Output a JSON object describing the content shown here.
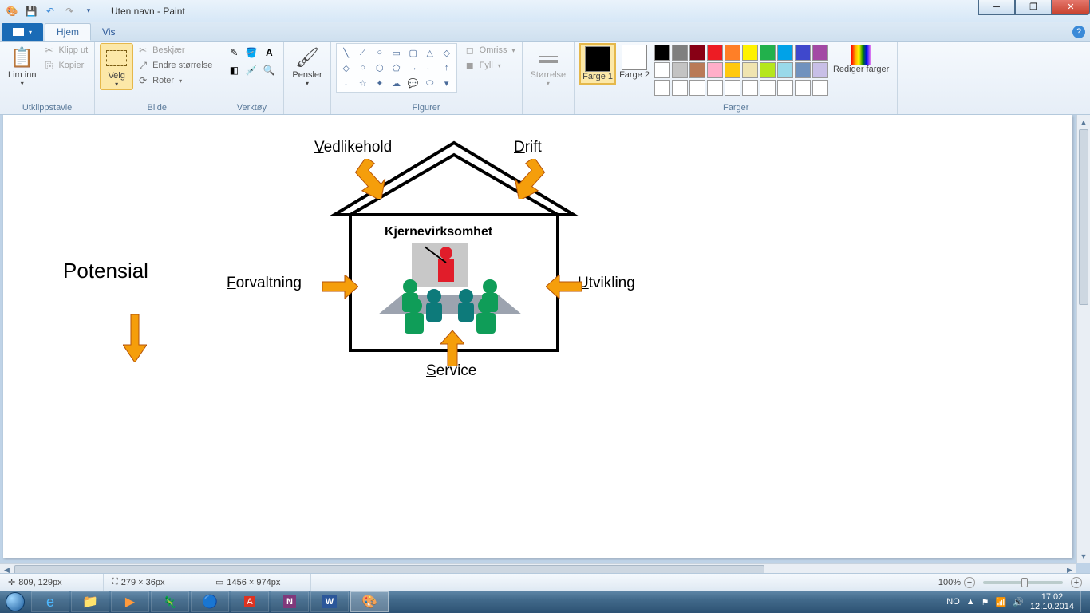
{
  "titlebar": {
    "title": "Uten navn - Paint"
  },
  "tabs": {
    "file": "",
    "home": "Hjem",
    "view": "Vis"
  },
  "ribbon": {
    "clipboard": {
      "label": "Utklippstavle",
      "paste": "Lim inn",
      "cut": "Klipp ut",
      "copy": "Kopier"
    },
    "image": {
      "label": "Bilde",
      "select": "Velg",
      "crop": "Beskjær",
      "resize": "Endre størrelse",
      "rotate": "Roter"
    },
    "tools": {
      "label": "Verktøy"
    },
    "brushes": {
      "label": "Pensler"
    },
    "shapes": {
      "label": "Figurer",
      "outline": "Omriss",
      "fill": "Fyll"
    },
    "size": {
      "label": "Størrelse"
    },
    "colors": {
      "label": "Farger",
      "color1": "Farge 1",
      "color2": "Farge 2",
      "edit": "Rediger farger"
    }
  },
  "drawing": {
    "potensial": "Potensial",
    "vedlikehold": "Vedlikehold",
    "drift": "Drift",
    "forvaltning": "Forvaltning",
    "utvikling": "Utvikling",
    "service": "Service",
    "kjerne": "Kjernevirksomhet"
  },
  "status": {
    "cursor": "809, 129px",
    "selection": "279 × 36px",
    "canvas": "1456 × 974px",
    "zoom": "100%"
  },
  "tray": {
    "lang": "NO",
    "time": "17:02",
    "date": "12.10.2014"
  },
  "palette": [
    "#000000",
    "#7f7f7f",
    "#880015",
    "#ed1c24",
    "#ff7f27",
    "#fff200",
    "#22b14c",
    "#00a2e8",
    "#3f48cc",
    "#a349a4",
    "#ffffff",
    "#c3c3c3",
    "#b97a57",
    "#ffaec9",
    "#ffc90e",
    "#efe4b0",
    "#b5e61d",
    "#99d9ea",
    "#7092be",
    "#c8bfe7"
  ]
}
